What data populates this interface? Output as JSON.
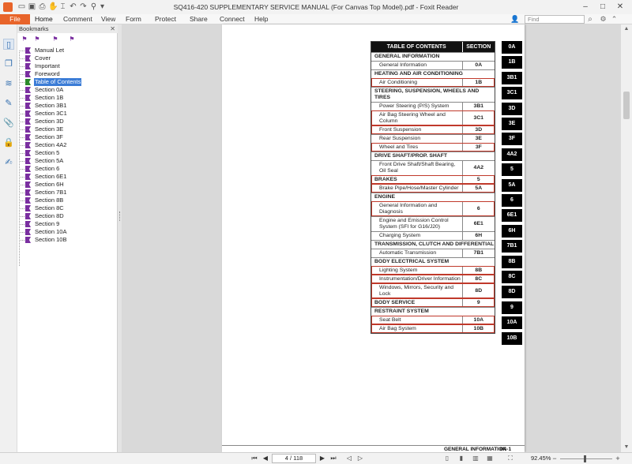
{
  "window": {
    "title": "SQ416-420 SUPPLEMENTARY SERVICE MANUAL (For Canvas Top Model).pdf - Foxit Reader",
    "min_icon": "minimize-icon",
    "max_icon": "maximize-icon",
    "close_icon": "close-icon"
  },
  "menu": {
    "file": "File",
    "items": [
      "Home",
      "Comment",
      "View",
      "Form",
      "Protect",
      "Share",
      "Connect",
      "Help"
    ],
    "search_placeholder": "Find"
  },
  "bookmarks": {
    "header": "Bookmarks",
    "items": [
      "Manual Let",
      "Cover",
      "Important",
      "Foreword",
      "Table of Contents",
      "Section 0A",
      "Section 1B",
      "Section 3B1",
      "Section 3C1",
      "Section 3D",
      "Section 3E",
      "Section 3F",
      "Section 4A2",
      "Section 5",
      "Section 5A",
      "Section 6",
      "Section 6E1",
      "Section 6H",
      "Section 7B1",
      "Section 8B",
      "Section 8C",
      "Section 8D",
      "Section 9",
      "Section 10A",
      "Section 10B"
    ],
    "selected_index": 4
  },
  "toc": {
    "header_title": "TABLE OF CONTENTS",
    "header_section": "SECTION",
    "rows": [
      {
        "type": "group",
        "title": "GENERAL INFORMATION",
        "section": ""
      },
      {
        "type": "item",
        "title": "General Information",
        "section": "0A"
      },
      {
        "type": "group",
        "title": "HEATING AND AIR CONDITIONING",
        "section": ""
      },
      {
        "type": "item",
        "title": "Air Conditioning",
        "section": "1B",
        "red": true
      },
      {
        "type": "group",
        "title": "STEERING, SUSPENSION, WHEELS AND TIRES",
        "section": ""
      },
      {
        "type": "item",
        "title": "Power Steering (P/S) System",
        "section": "3B1"
      },
      {
        "type": "item",
        "title": "Air Bag Steering Wheel and Column",
        "section": "3C1",
        "red": true
      },
      {
        "type": "item",
        "title": "Front Suspension",
        "section": "3D",
        "red": true
      },
      {
        "type": "item",
        "title": "Rear Suspension",
        "section": "3E"
      },
      {
        "type": "item",
        "title": "Wheel and Tires",
        "section": "3F",
        "red": true
      },
      {
        "type": "group",
        "title": "DRIVE SHAFT/PROP. SHAFT",
        "section": ""
      },
      {
        "type": "item",
        "title": "Front Drive Shaft/Shaft Bearing, Oil Seal",
        "section": "4A2"
      },
      {
        "type": "grouprow",
        "title": "BRAKES",
        "section": "5",
        "red": true
      },
      {
        "type": "item",
        "title": "Brake Pipe/Hose/Master Cylinder",
        "section": "5A",
        "red": true
      },
      {
        "type": "group",
        "title": "ENGINE",
        "section": ""
      },
      {
        "type": "item",
        "title": "General Information and Diagnosis",
        "section": "6",
        "red": true
      },
      {
        "type": "item",
        "title": "Engine and Emission Control System (SFI for G16/J20)",
        "section": "6E1"
      },
      {
        "type": "item",
        "title": "Charging System",
        "section": "6H"
      },
      {
        "type": "group",
        "title": "TRANSMISSION, CLUTCH AND DIFFERENTIAL",
        "section": ""
      },
      {
        "type": "item",
        "title": "Automatic Transmission",
        "section": "7B1"
      },
      {
        "type": "group",
        "title": "BODY ELECTRICAL SYSTEM",
        "section": ""
      },
      {
        "type": "item",
        "title": "Lighting System",
        "section": "8B",
        "red": true
      },
      {
        "type": "item",
        "title": "Instrumentation/Driver Information",
        "section": "8C",
        "red": true
      },
      {
        "type": "item",
        "title": "Windows, Mirrors, Security and Lock",
        "section": "8D",
        "red": true
      },
      {
        "type": "grouprow",
        "title": "BODY SERVICE",
        "section": "9",
        "red": true
      },
      {
        "type": "group",
        "title": "RESTRAINT SYSTEM",
        "section": ""
      },
      {
        "type": "item",
        "title": "Seat Belt",
        "section": "10A",
        "red": true
      },
      {
        "type": "item",
        "title": "Air Bag System",
        "section": "10B",
        "red": true
      }
    ]
  },
  "tabs": [
    "0A",
    "1B",
    "3B1",
    "3C1",
    "3D",
    "3E",
    "3F",
    "4A2",
    "5",
    "5A",
    "6",
    "6E1",
    "6H",
    "7B1",
    "8B",
    "8C",
    "8D",
    "9",
    "10A",
    "10B"
  ],
  "page_footer": {
    "left": "GENERAL INFORMATION",
    "right": "0A-1"
  },
  "status": {
    "page_display": "4 / 118",
    "zoom": "92.45%"
  },
  "colors": {
    "accent": "#e8642a",
    "selection": "#3b7cd6",
    "bookmark_flag": "#7a2fa0",
    "highlight_box": "#c0392b"
  }
}
